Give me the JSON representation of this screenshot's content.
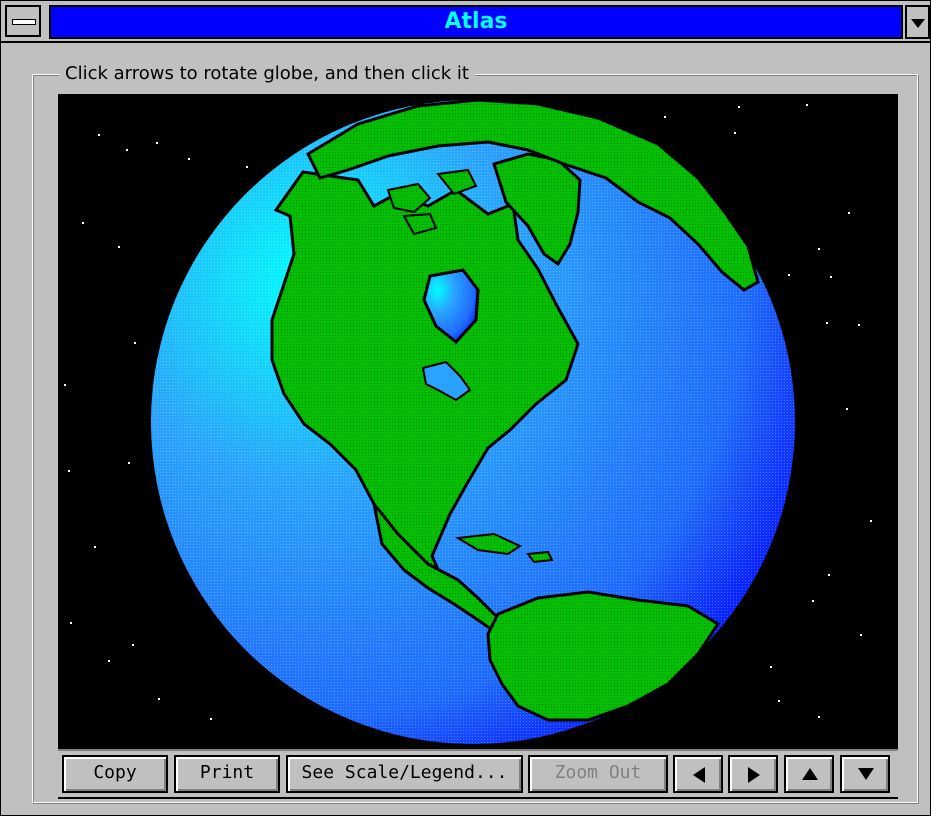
{
  "window": {
    "title": "Atlas",
    "title_bg": "#0000ff",
    "title_fg": "#00ffff",
    "system_menu_icon": "system-menu-icon",
    "dropdown_icon": "chevron-down-icon"
  },
  "group": {
    "label": "Click arrows to rotate globe, and then click it"
  },
  "map": {
    "view": "North America, globe view",
    "ocean_color": "#1e6bff",
    "land_color": "#00c000",
    "space_color": "#000000"
  },
  "toolbar": {
    "copy_label": "Copy",
    "print_label": "Print",
    "scale_label": "See Scale/Legend...",
    "zoom_out_label": "Zoom Out",
    "zoom_out_enabled": false,
    "left_icon": "arrow-left-icon",
    "right_icon": "arrow-right-icon",
    "up_icon": "arrow-up-icon",
    "down_icon": "arrow-down-icon"
  }
}
